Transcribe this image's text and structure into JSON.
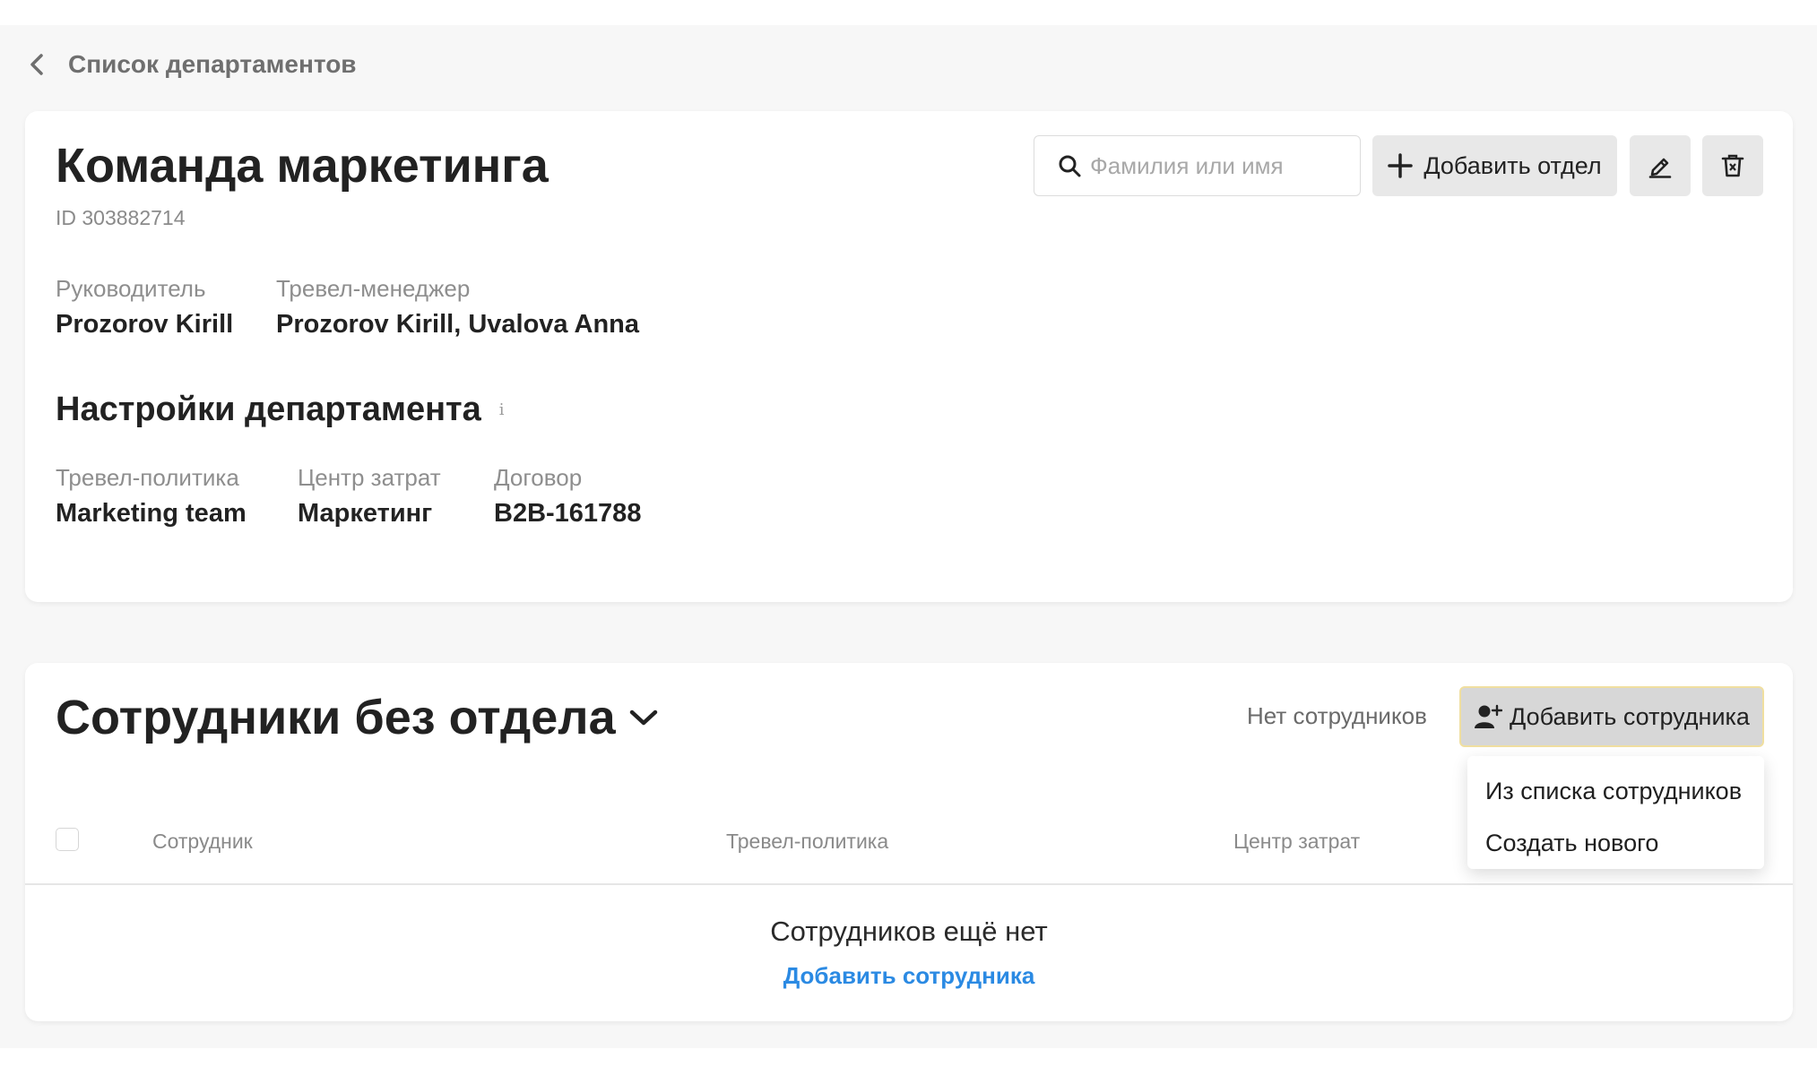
{
  "back": {
    "label": "Список департаментов"
  },
  "department": {
    "title": "Команда маркетинга",
    "id_text": "ID 303882714",
    "head": {
      "label": "Руководитель",
      "value": "Prozorov Kirill"
    },
    "travel_manager": {
      "label": "Тревел-менеджер",
      "value": "Prozorov Kirill, Uvalova Anna"
    }
  },
  "toolbar": {
    "search_placeholder": "Фамилия или имя",
    "add_department_label": "Добавить отдел"
  },
  "settings": {
    "title": "Настройки департамента",
    "info_glyph": "i",
    "travel_policy": {
      "label": "Тревел-политика",
      "value": "Marketing team"
    },
    "cost_center": {
      "label": "Центр затрат",
      "value": "Маркетинг"
    },
    "contract": {
      "label": "Договор",
      "value": "B2B-161788"
    }
  },
  "employees": {
    "title": "Сотрудники без отдела",
    "status": "Нет сотрудников",
    "add_button_label": "Добавить сотрудника",
    "dropdown": [
      "Из списка сотрудников",
      "Создать нового"
    ],
    "columns": [
      "Сотрудник",
      "Тревел-политика",
      "Центр затрат"
    ],
    "empty_title": "Сотрудников ещё нет",
    "empty_link": "Добавить сотрудника"
  },
  "colors": {
    "link": "#2b8ae3",
    "button_bg": "#e8e8e8",
    "active_button_bg": "#d7d7d7",
    "page_bg": "#f7f7f7"
  },
  "icons": {
    "back": "chevron-left-icon",
    "search": "search-icon",
    "add": "plus-icon",
    "edit": "pencil-icon",
    "delete": "trash-icon",
    "info": "info-icon",
    "collapse": "chevron-down-icon",
    "add_user": "user-plus-icon"
  }
}
